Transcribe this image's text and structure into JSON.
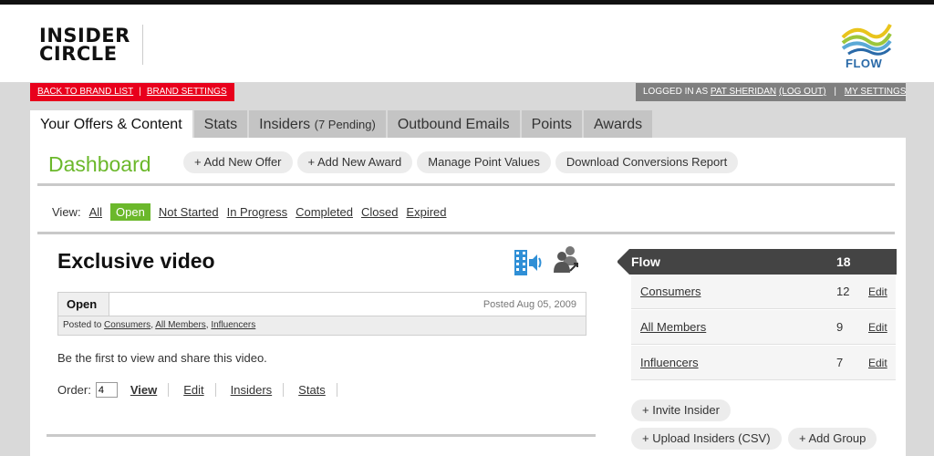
{
  "header": {
    "logo_line1": "INSIDER",
    "logo_line2": "CIRCLE",
    "brand_name": "FLOW"
  },
  "utility": {
    "back_label": "BACK TO BRAND LIST",
    "separator": "|",
    "brand_settings_label": "BRAND SETTINGS",
    "logged_in_prefix": "LOGGED IN AS",
    "user_name": "PAT SHERIDAN",
    "logout_label": "(LOG OUT)",
    "my_settings_label": "MY SETTINGS"
  },
  "tabs": [
    {
      "label": "Your Offers & Content",
      "active": true
    },
    {
      "label": "Stats"
    },
    {
      "label": "Insiders",
      "badge": "(7 Pending)"
    },
    {
      "label": "Outbound Emails"
    },
    {
      "label": "Points"
    },
    {
      "label": "Awards"
    }
  ],
  "dashboard": {
    "title": "Dashboard",
    "actions": [
      "+ Add New Offer",
      "+ Add New Award",
      "Manage Point Values",
      "Download Conversions Report"
    ]
  },
  "view_filter": {
    "label": "View:",
    "options": [
      "All",
      "Open",
      "Not Started",
      "In Progress",
      "Completed",
      "Closed",
      "Expired"
    ],
    "selected": "Open"
  },
  "offer": {
    "title": "Exclusive video",
    "status": "Open",
    "posted": "Posted Aug 05, 2009",
    "posted_to_label": "Posted to",
    "posted_to": [
      "Consumers",
      "All Members",
      "Influencers"
    ],
    "description": "Be the first to view and share this video.",
    "order_label": "Order:",
    "order_value": "4",
    "links": [
      "View",
      "Edit",
      "Insiders",
      "Stats"
    ],
    "icons": [
      "video-audio-icon",
      "people-share-icon"
    ]
  },
  "sidebar": {
    "brand": "Flow",
    "brand_count": "18",
    "groups": [
      {
        "name": "Consumers",
        "count": "12",
        "edit": "Edit"
      },
      {
        "name": "All Members",
        "count": "9",
        "edit": "Edit"
      },
      {
        "name": "Influencers",
        "count": "7",
        "edit": "Edit"
      }
    ],
    "buttons": [
      "+ Invite Insider",
      "+ Upload Insiders (CSV)",
      "+ Add Group"
    ]
  },
  "colors": {
    "accent_green": "#6bb82b",
    "alert_red": "#e8001c",
    "brand_blue": "#2a6aa8"
  }
}
